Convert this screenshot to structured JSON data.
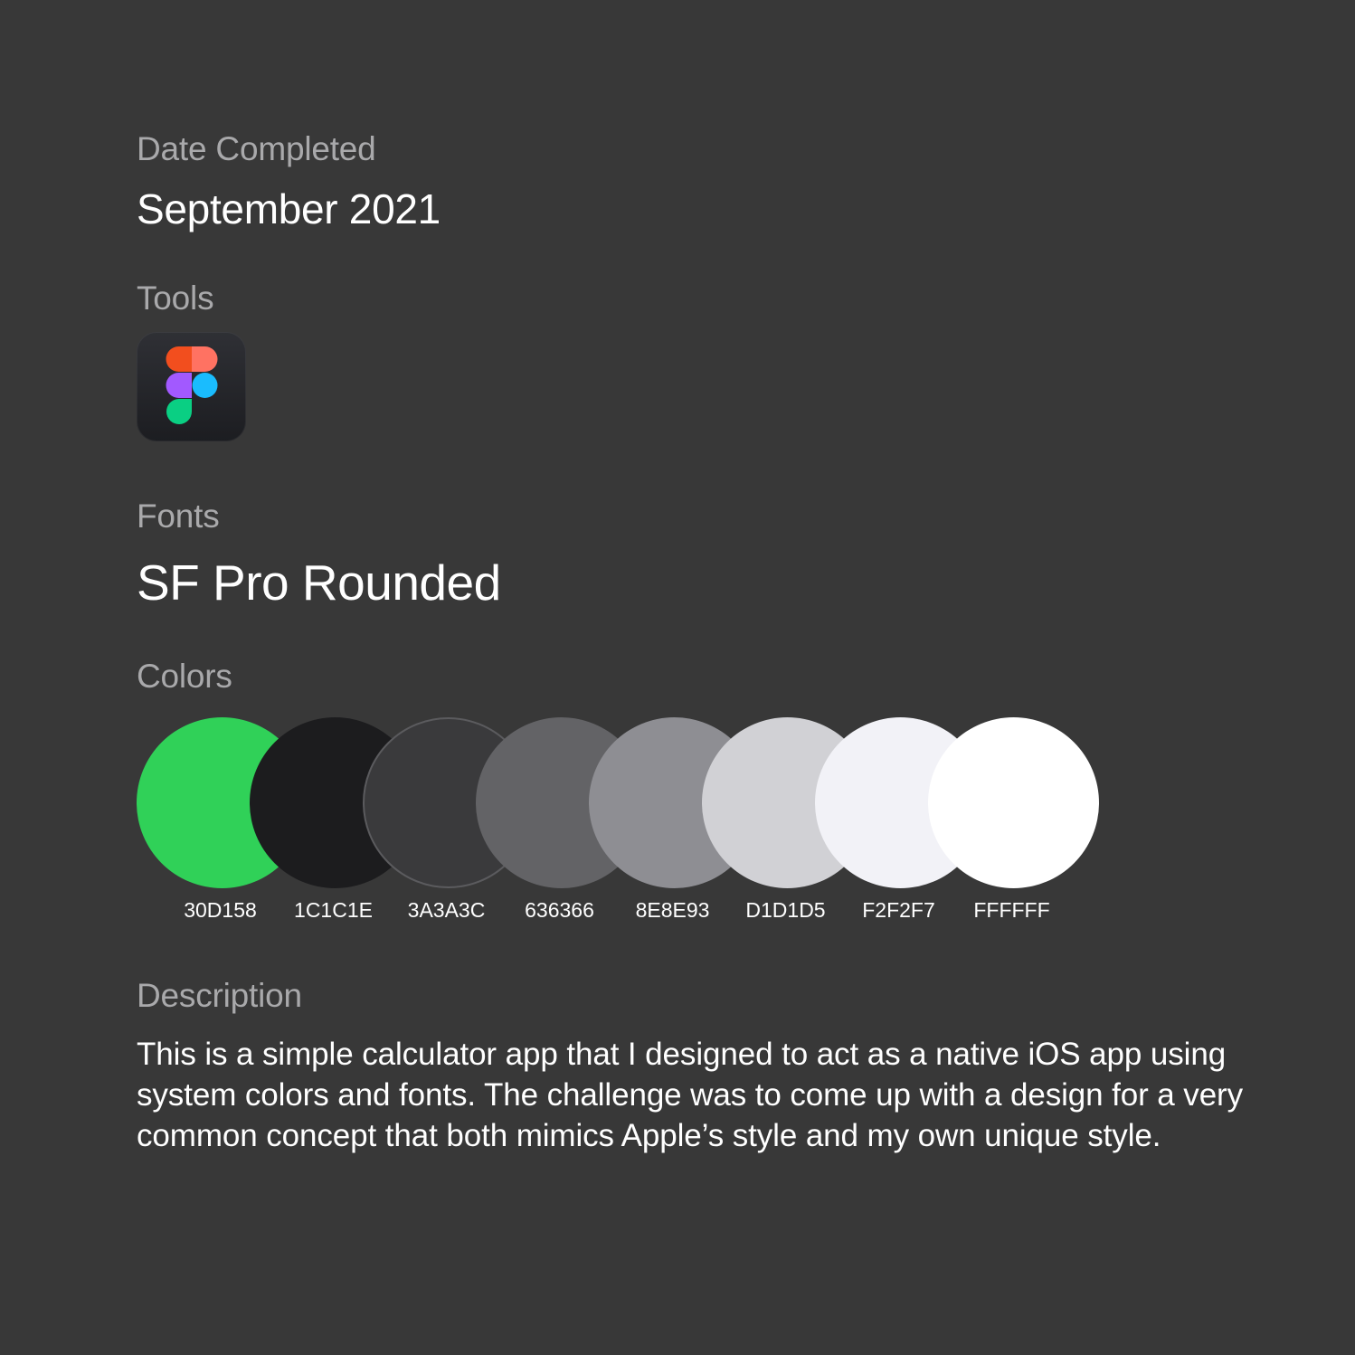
{
  "sections": {
    "date": {
      "label": "Date Completed",
      "value": "September 2021"
    },
    "tools": {
      "label": "Tools",
      "items": [
        {
          "name": "figma-icon"
        }
      ]
    },
    "fonts": {
      "label": "Fonts",
      "value": "SF Pro Rounded"
    },
    "colors": {
      "label": "Colors",
      "swatches": [
        {
          "code": "30D158",
          "hex": "#30D158"
        },
        {
          "code": "1C1C1E",
          "hex": "#1C1C1E"
        },
        {
          "code": "3A3A3C",
          "hex": "#3A3A3C"
        },
        {
          "code": "636366",
          "hex": "#636366"
        },
        {
          "code": "8E8E93",
          "hex": "#8E8E93"
        },
        {
          "code": "D1D1D5",
          "hex": "#D1D1D5"
        },
        {
          "code": "F2F2F7",
          "hex": "#F2F2F7"
        },
        {
          "code": "FFFFFF",
          "hex": "#FFFFFF"
        }
      ]
    },
    "description": {
      "label": "Description",
      "text": "This is a simple calculator app that I designed to act as a native iOS app using system colors and fonts. The challenge was to come up with a design for a very common concept that both mimics Apple’s style and my own unique style."
    }
  },
  "theme": {
    "background": "#383838",
    "label_color": "#A9A9AB",
    "text_color": "#FFFFFF"
  }
}
